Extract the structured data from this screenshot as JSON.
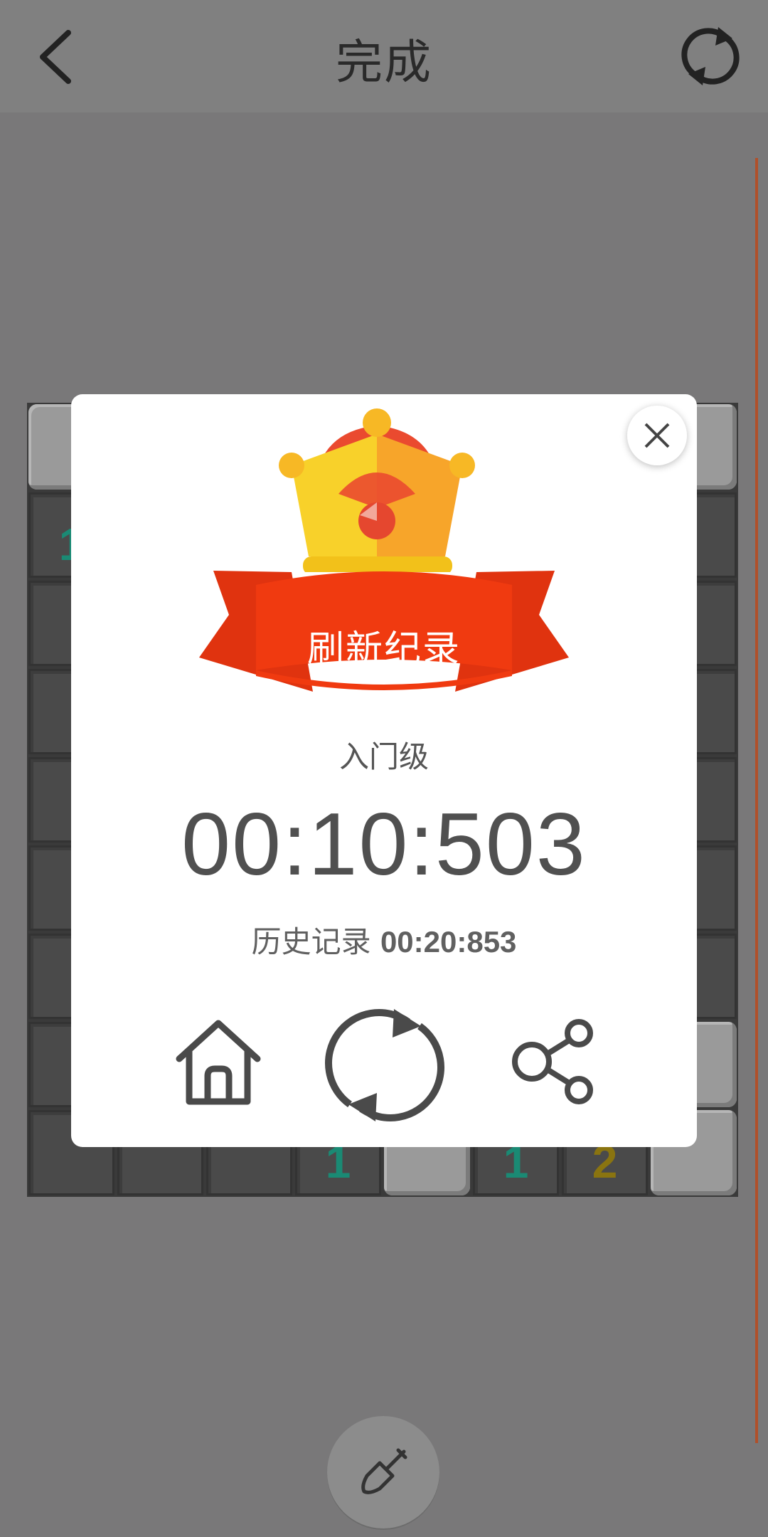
{
  "header": {
    "title": "完成",
    "back_icon": "chevron-left-icon",
    "refresh_icon": "refresh-icon"
  },
  "board": {
    "visible_numbers": [
      {
        "row": 1,
        "col": 0,
        "text": "1",
        "color": "#1a8a74"
      },
      {
        "row": 8,
        "col": 3,
        "text": "1",
        "color": "#1a8a74"
      },
      {
        "row": 8,
        "col": 5,
        "text": "1",
        "color": "#1a8a74"
      },
      {
        "row": 8,
        "col": 6,
        "text": "2",
        "color": "#8a7410"
      }
    ]
  },
  "dialog": {
    "banner_text": "刷新纪录",
    "level": "入门级",
    "time": "00:10:503",
    "history_label": "历史记录",
    "history_time": "00:20:853",
    "icons": [
      "close-icon",
      "crown-icon",
      "home-icon",
      "replay-icon",
      "share-icon"
    ]
  },
  "bottom": {
    "tool_icon": "shovel-icon"
  },
  "colors": {
    "overlay": "#797879",
    "ribbon": "#f03a10",
    "crown_gold": "#f7c21e",
    "crown_red": "#ea4a2f"
  }
}
